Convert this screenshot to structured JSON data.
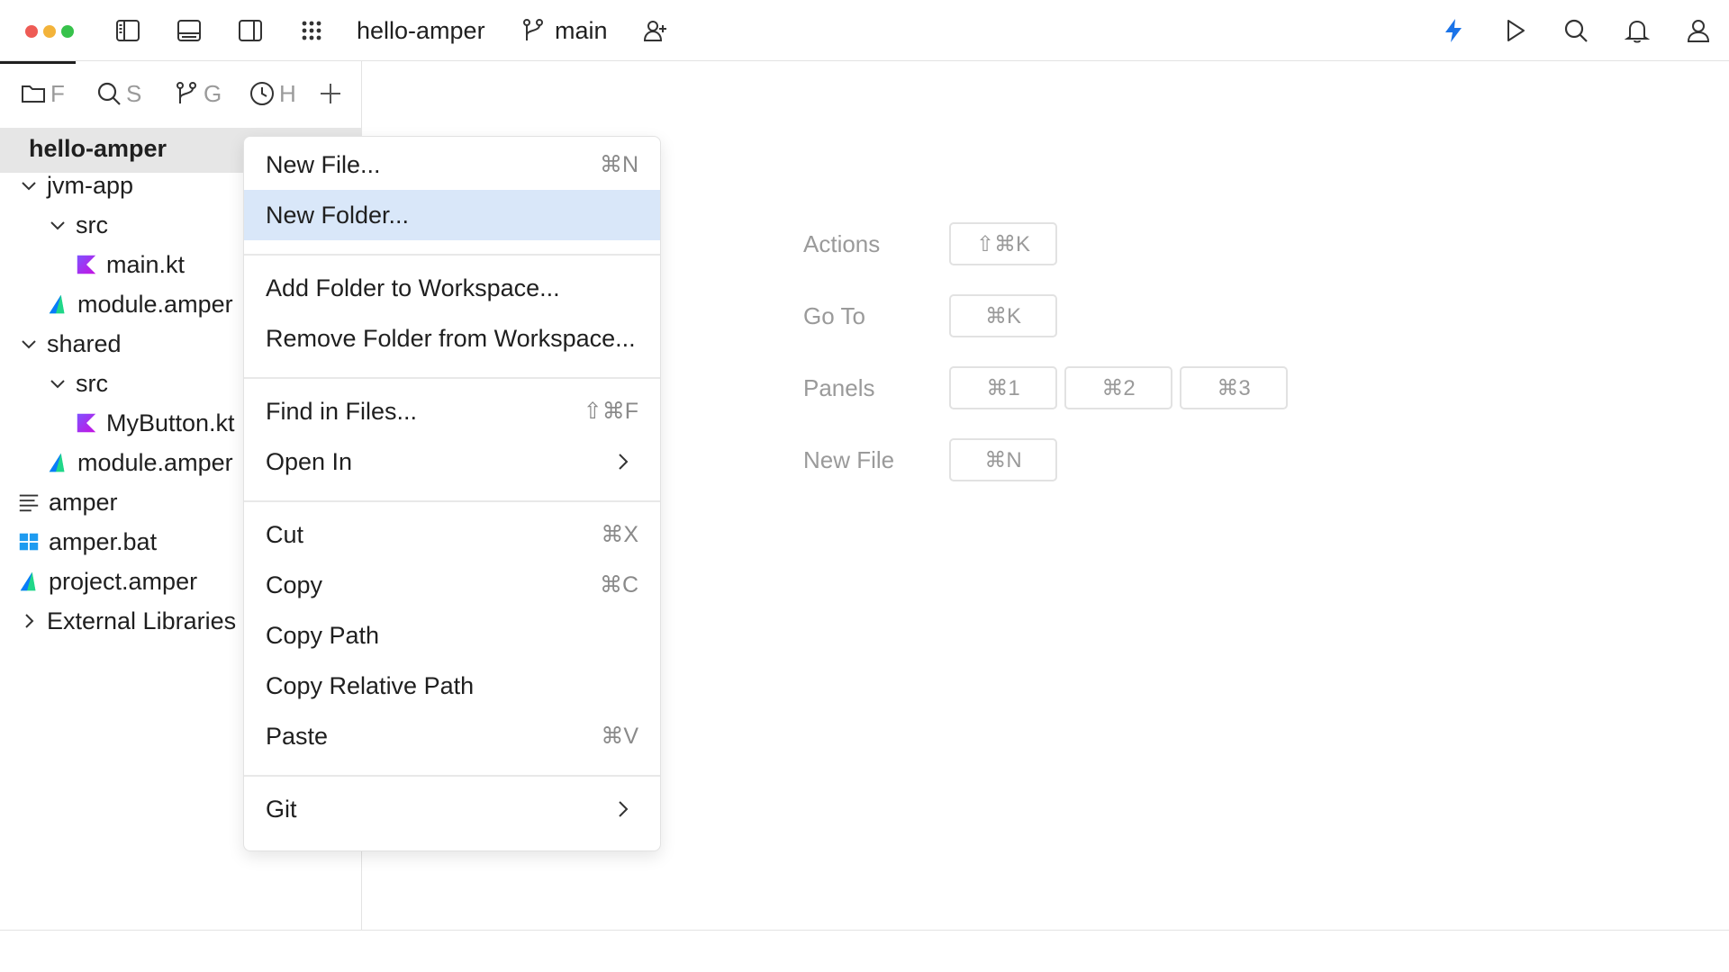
{
  "titlebar": {
    "project": "hello-amper",
    "branch": "main",
    "colors": {
      "close": "#ee5b55",
      "minimize": "#f3b33a",
      "maximize": "#37c24b",
      "accent": "#1a73e8"
    },
    "icons": [
      "toggle-left-panel-icon",
      "toggle-bottom-panel-icon",
      "toggle-right-panel-icon",
      "apps-grid-icon",
      "git-branch-icon",
      "add-person-icon",
      "lightning-icon",
      "run-icon",
      "search-icon",
      "bell-icon",
      "user-icon"
    ]
  },
  "sidebar": {
    "tabs": [
      {
        "icon": "folder-icon",
        "label": "F"
      },
      {
        "icon": "search-icon",
        "label": "S"
      },
      {
        "icon": "git-branch-icon",
        "label": "G"
      },
      {
        "icon": "history-icon",
        "label": "H"
      },
      {
        "icon": "plus-icon",
        "label": ""
      }
    ],
    "root": "hello-amper",
    "tree": [
      {
        "label": "jvm-app",
        "icon": "none",
        "chevron": "down"
      },
      {
        "label": "src",
        "icon": "none",
        "chevron": "down"
      },
      {
        "label": "main.kt",
        "icon": "kotlin-file-icon",
        "chevron": ""
      },
      {
        "label": "module.amper",
        "icon": "amper-file-icon",
        "chevron": ""
      },
      {
        "label": "shared",
        "icon": "none",
        "chevron": "down"
      },
      {
        "label": "src",
        "icon": "none",
        "chevron": "down"
      },
      {
        "label": "MyButton.kt",
        "icon": "kotlin-file-icon",
        "chevron": ""
      },
      {
        "label": "module.amper",
        "icon": "amper-file-icon",
        "chevron": ""
      },
      {
        "label": "amper",
        "icon": "text-file-icon",
        "chevron": ""
      },
      {
        "label": "amper.bat",
        "icon": "windows-file-icon",
        "chevron": ""
      },
      {
        "label": "project.amper",
        "icon": "amper-file-icon",
        "chevron": ""
      },
      {
        "label": "External Libraries",
        "icon": "none",
        "chevron": "right"
      }
    ]
  },
  "context_menu": {
    "highlighted": "New Folder...",
    "items": [
      {
        "label": "New File...",
        "shortcut": "⌘N"
      },
      {
        "label": "New Folder...",
        "shortcut": ""
      },
      {
        "label": "Add Folder to Workspace...",
        "shortcut": ""
      },
      {
        "label": "Remove Folder from Workspace...",
        "shortcut": ""
      },
      {
        "label": "Find in Files...",
        "shortcut": "⇧⌘F"
      },
      {
        "label": "Open In",
        "shortcut": "",
        "submenu": true
      },
      {
        "label": "Cut",
        "shortcut": "⌘X"
      },
      {
        "label": "Copy",
        "shortcut": "⌘C"
      },
      {
        "label": "Copy Path",
        "shortcut": ""
      },
      {
        "label": "Copy Relative Path",
        "shortcut": ""
      },
      {
        "label": "Paste",
        "shortcut": "⌘V"
      },
      {
        "label": "Git",
        "shortcut": "",
        "submenu": true
      }
    ]
  },
  "welcome": {
    "shortcuts": [
      {
        "label": "Actions",
        "keys": [
          "⇧⌘K"
        ]
      },
      {
        "label": "Go To",
        "keys": [
          "⌘K"
        ]
      },
      {
        "label": "Panels",
        "keys": [
          "⌘1",
          "⌘2",
          "⌘3"
        ]
      },
      {
        "label": "New File",
        "keys": [
          "⌘N"
        ]
      }
    ]
  }
}
